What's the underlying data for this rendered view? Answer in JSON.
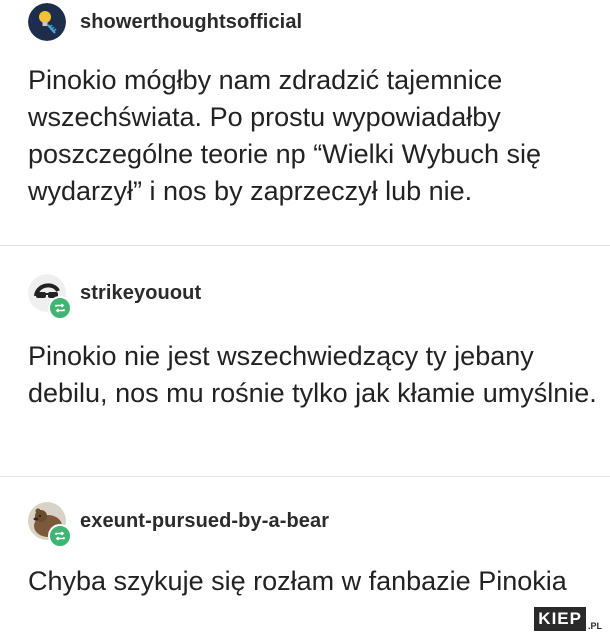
{
  "posts": [
    {
      "username": "showerthoughtsofficial",
      "avatar_icon": "lightbulb-avatar-icon",
      "text": "Pinokio mógłby nam zdradzić tajemnice wszechświata. Po prostu wypowiadałby poszczególne teorie np “Wielki Wybuch się wydarzył” i nos by zaprzeczył lub nie."
    },
    {
      "username": "strikeyouout",
      "avatar_icon": "sunglasses-avatar-icon",
      "reblog_icon": "reblog-icon",
      "text": "Pinokio nie jest wszechwiedzący ty jebany debilu, nos mu rośnie tylko jak kłamie umyślnie."
    },
    {
      "username": "exeunt-pursued-by-a-bear",
      "avatar_icon": "bear-avatar-icon",
      "reblog_icon": "reblog-icon",
      "text": "Chyba szykuje się rozłam w fanbazie Pinokia"
    }
  ],
  "watermark": {
    "main": "KIEP",
    "sub": ".PL"
  },
  "colors": {
    "reblog_badge": "#3fb573",
    "divider": "#e3e3e3",
    "text": "#222222"
  }
}
